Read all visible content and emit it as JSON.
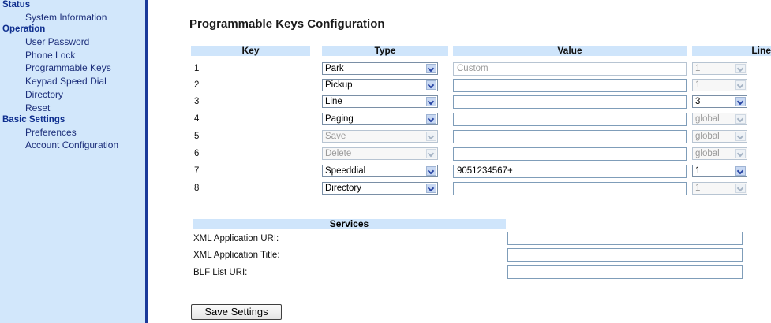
{
  "sidebar": {
    "sections": [
      {
        "title": "Status",
        "items": [
          "System Information"
        ]
      },
      {
        "title": "Operation",
        "items": [
          "User Password",
          "Phone Lock",
          "Programmable Keys",
          "Keypad Speed Dial",
          "Directory",
          "Reset"
        ]
      },
      {
        "title": "Basic Settings",
        "items": [
          "Preferences",
          "Account Configuration"
        ]
      }
    ]
  },
  "page": {
    "title": "Programmable Keys Configuration"
  },
  "table": {
    "headers": {
      "key": "Key",
      "type": "Type",
      "value": "Value",
      "line": "Line"
    },
    "rows": [
      {
        "key": "1",
        "type": "Park",
        "type_disabled": false,
        "value": "Custom",
        "value_placeholder": true,
        "line": "1",
        "line_disabled": true
      },
      {
        "key": "2",
        "type": "Pickup",
        "type_disabled": false,
        "value": "",
        "value_placeholder": false,
        "line": "1",
        "line_disabled": true
      },
      {
        "key": "3",
        "type": "Line",
        "type_disabled": false,
        "value": "",
        "value_placeholder": false,
        "line": "3",
        "line_disabled": false
      },
      {
        "key": "4",
        "type": "Paging",
        "type_disabled": false,
        "value": "",
        "value_placeholder": false,
        "line": "global",
        "line_disabled": true
      },
      {
        "key": "5",
        "type": "Save",
        "type_disabled": true,
        "value": "",
        "value_placeholder": false,
        "line": "global",
        "line_disabled": true
      },
      {
        "key": "6",
        "type": "Delete",
        "type_disabled": true,
        "value": "",
        "value_placeholder": false,
        "line": "global",
        "line_disabled": true
      },
      {
        "key": "7",
        "type": "Speeddial",
        "type_disabled": false,
        "value": "9051234567+",
        "value_placeholder": false,
        "line": "1",
        "line_disabled": false
      },
      {
        "key": "8",
        "type": "Directory",
        "type_disabled": false,
        "value": "",
        "value_placeholder": false,
        "line": "1",
        "line_disabled": true
      }
    ]
  },
  "services": {
    "header": "Services",
    "fields": [
      {
        "label": "XML Application URI:",
        "value": ""
      },
      {
        "label": "XML Application Title:",
        "value": ""
      },
      {
        "label": "BLF List URI:",
        "value": ""
      }
    ]
  },
  "actions": {
    "save_label": "Save Settings"
  },
  "colors": {
    "sidebar_bg": "#d2e7fb",
    "sidebar_border": "#1b3a9a",
    "header_bg": "#cfe5fb",
    "section_text": "#0f2f8f"
  }
}
